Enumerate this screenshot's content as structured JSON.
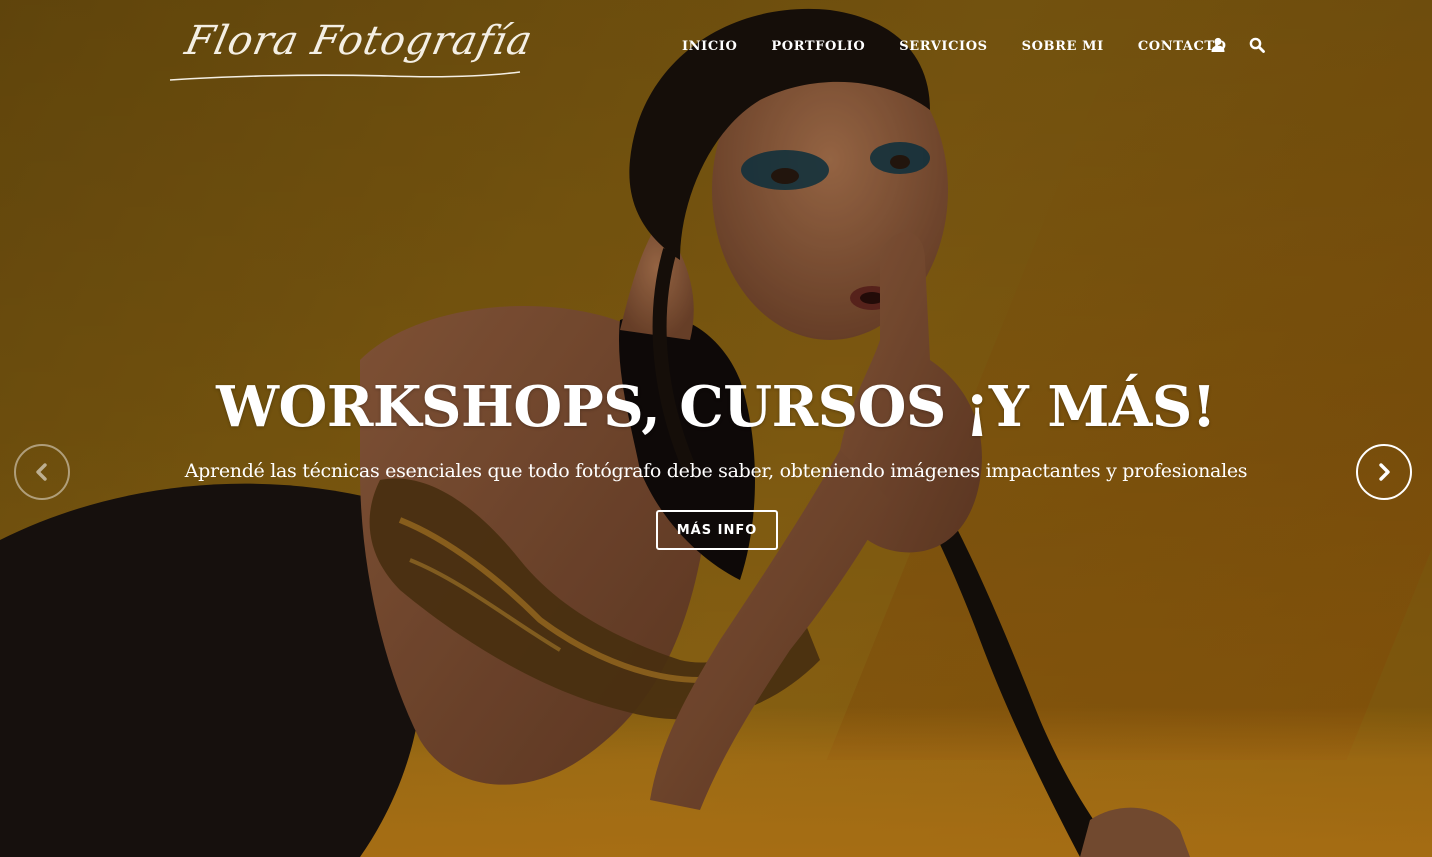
{
  "site": {
    "logo_text": "Flora Fotografía"
  },
  "nav": {
    "items": [
      {
        "label": "INICIO"
      },
      {
        "label": "PORTFOLIO"
      },
      {
        "label": "SERVICIOS"
      },
      {
        "label": "SOBRE MI"
      },
      {
        "label": "CONTACTO"
      }
    ],
    "user_icon": "user-icon",
    "search_icon": "search-icon"
  },
  "hero": {
    "title": "WORKSHOPS, CURSOS ¡Y MÁS!",
    "subtitle": "Aprendé las técnicas esenciales que todo fotógrafo debe saber, obteniendo imágenes impactantes y profesionales",
    "cta_label": "MÁS INFO",
    "prev_icon": "chevron-left-icon",
    "next_icon": "chevron-right-icon"
  },
  "colors": {
    "backdrop": "#c98a12",
    "text": "#ffffff"
  }
}
